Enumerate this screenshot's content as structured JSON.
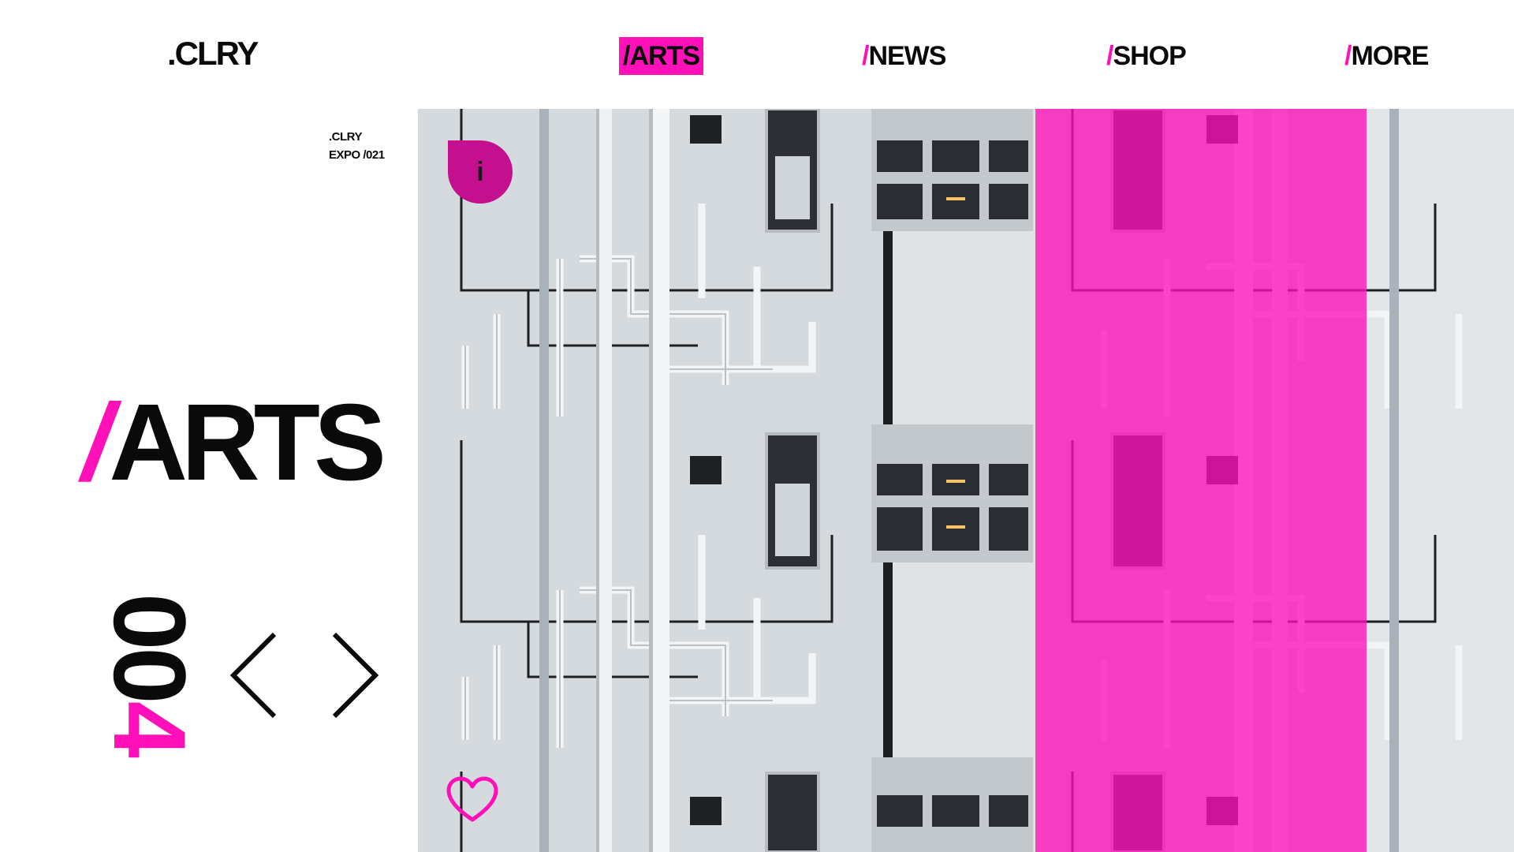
{
  "brand": {
    "logo": ".CLRY"
  },
  "nav": {
    "items": [
      {
        "slash": "/",
        "label": "ARTS",
        "active": true
      },
      {
        "slash": "/",
        "label": "NEWS",
        "active": false
      },
      {
        "slash": "/",
        "label": "SHOP",
        "active": false
      },
      {
        "slash": "/",
        "label": "MORE",
        "active": false
      }
    ]
  },
  "sidebar": {
    "meta_line1": ".CLRY",
    "meta_line2": "EXPO /021",
    "title_slash": "/",
    "title": "ARTS",
    "counter_main": "00",
    "counter_accent": "4"
  },
  "controls": {
    "prev_icon": "chevron-left-icon",
    "next_icon": "chevron-right-icon",
    "info_label": "i",
    "info_icon": "info-icon",
    "like_icon": "heart-icon"
  },
  "colors": {
    "accent": "#ff10b8",
    "accent_dark": "#c40f8f",
    "text": "#0a0a0a",
    "background": "#ffffff",
    "wall": "#d9dee3"
  }
}
